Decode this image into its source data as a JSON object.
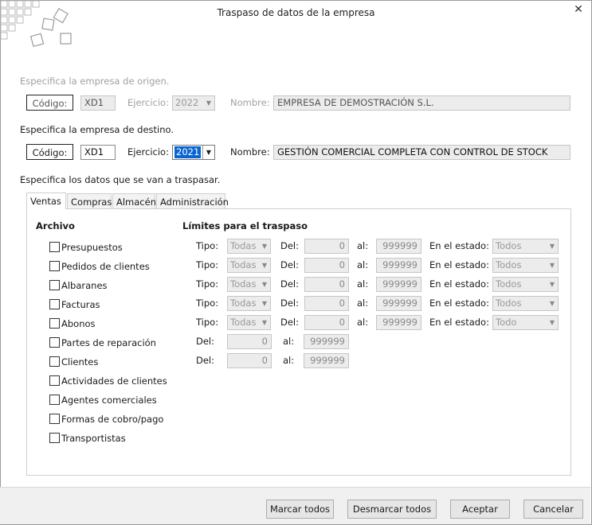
{
  "window": {
    "title": "Traspaso de datos de la empresa",
    "close_glyph": "✕"
  },
  "origin": {
    "heading": "Especifica la empresa de origen.",
    "code_button": "Código:",
    "code_value": "XD1",
    "year_label": "Ejercicio:",
    "year_value": "2022",
    "name_label": "Nombre:",
    "name_value": "EMPRESA DE DEMOSTRACIÓN S.L."
  },
  "destination": {
    "heading": "Especifica la empresa de destino.",
    "code_button": "Código:",
    "code_value": "XD1",
    "year_label": "Ejercicio:",
    "year_value": "2021",
    "name_label": "Nombre:",
    "name_value": "GESTIÓN COMERCIAL COMPLETA CON CONTROL DE STOCK"
  },
  "data_heading": "Especifica los datos que se van a traspasar.",
  "tabs": [
    "Ventas",
    "Compras",
    "Almacén",
    "Administración"
  ],
  "archivo": {
    "header": "Archivo",
    "items": [
      "Presupuestos",
      "Pedidos de clientes",
      "Albaranes",
      "Facturas",
      "Abonos",
      "Partes de reparación",
      "Clientes",
      "Actividades de clientes",
      "Agentes comerciales",
      "Formas de cobro/pago",
      "Transportistas"
    ]
  },
  "limits": {
    "header": "Límites para el traspaso",
    "tipo_label": "Tipo:",
    "del_label": "Del:",
    "al_label": "al:",
    "estado_label": "En el estado:",
    "rows": [
      {
        "tipo": "Todas",
        "del": "0",
        "al": "999999",
        "estado": "Todos"
      },
      {
        "tipo": "Todas",
        "del": "0",
        "al": "999999",
        "estado": "Todos"
      },
      {
        "tipo": "Todas",
        "del": "0",
        "al": "999999",
        "estado": "Todos"
      },
      {
        "tipo": "Todas",
        "del": "0",
        "al": "999999",
        "estado": "Todos"
      },
      {
        "tipo": "Todas",
        "del": "0",
        "al": "999999",
        "estado": "Todo"
      }
    ],
    "simple_rows": [
      {
        "del": "0",
        "al": "999999"
      },
      {
        "del": "0",
        "al": "999999"
      }
    ]
  },
  "buttons": {
    "mark_all": "Marcar todos",
    "unmark_all": "Desmarcar todos",
    "accept": "Aceptar",
    "cancel": "Cancelar"
  }
}
